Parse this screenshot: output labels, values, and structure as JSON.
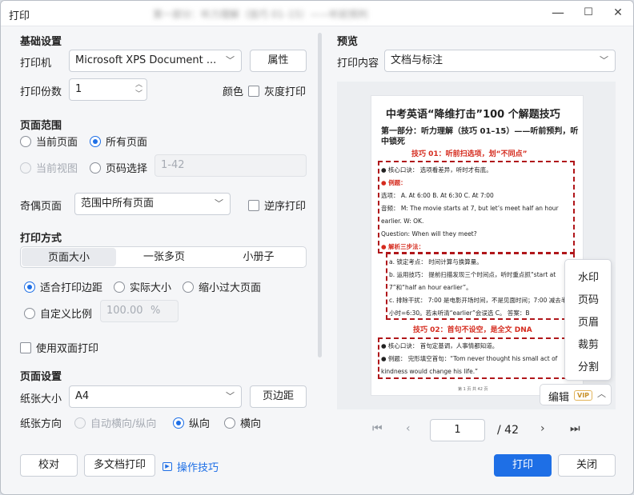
{
  "window": {
    "title": "打印",
    "blurred_title": "第一部分：听力理解（技巧 01–15）——听前预判",
    "min": "—",
    "max": "☐",
    "close": "✕"
  },
  "basic": {
    "title": "基础设置",
    "printer_label": "打印机",
    "printer_value": "Microsoft XPS Document ...",
    "props": "属性",
    "copies_label": "打印份数",
    "copies_value": "1",
    "color_label": "颜色",
    "gray_label": "灰度打印"
  },
  "range": {
    "title": "页面范围",
    "current": "当前页面",
    "all": "所有页面",
    "view": "当前视图",
    "pages": "页码选择",
    "pages_placeholder": "1-42"
  },
  "odd": {
    "label": "奇偶页面",
    "value": "范围中所有页面",
    "reverse": "逆序打印"
  },
  "mode": {
    "title": "打印方式",
    "tabs": [
      "页面大小",
      "一张多页",
      "小册子"
    ],
    "fit": "适合打印边距",
    "actual": "实际大小",
    "shrink": "缩小过大页面",
    "custom": "自定义比例",
    "custom_value": "100.00",
    "custom_unit": "%",
    "duplex": "使用双面打印"
  },
  "pagesetup": {
    "title": "页面设置",
    "size_label": "纸张大小",
    "size_value": "A4",
    "margin": "页边距",
    "orient_label": "纸张方向",
    "auto": "自动横向/纵向",
    "portrait": "纵向",
    "landscape": "横向"
  },
  "preview": {
    "title": "预览",
    "content_label": "打印内容",
    "content_value": "文档与标注"
  },
  "doc": {
    "title": "中考英语“降维打击”100 个解题技巧",
    "subtitle": "第一部分：听力理解（技巧 01–15）——听前预判，听中锁死",
    "tip1": "技巧 01：听前扫选项，划“不同点”",
    "l1": "● 核心口诀： 选项看差异，听时才有底。",
    "l2": "● 例题：",
    "l3": "选项： A. At 6:00 B. At 6:30 C. At 7:00",
    "l4": "音频： M: The movie starts at 7, but let’s meet half an hour",
    "l5": "earlier. W: OK.",
    "l6": "Question: When will they meet?",
    "l7": "● 解析三步法：",
    "l8": "a. 锁定考点： 时间计算与换算量。",
    "l9": "b. 运用技巧： 提前扫描发现三个时间点，听时重点抓“start at",
    "l10": "7”和“half an hour earlier”。",
    "l11": "c. 排除干扰： 7:00 是电影开场时间，不是见面时间；7:00 减去半",
    "l12": "小时=6:30。若未听清“earlier”会误选 C。 答案：B",
    "tip2": "技巧 02：首句不设空，是全文 DNA",
    "l13": "● 核心口诀： 首句定基调，人事情都知道。",
    "l14": "● 例题： 完形填空首句：“Tom never thought his small act of",
    "l15": "kindness would change his life.”",
    "footer": "第 1 页 共 42 页"
  },
  "menu": [
    "水印",
    "页码",
    "页眉",
    "裁剪",
    "分割"
  ],
  "edit": {
    "label": "编辑",
    "vip": "VIP"
  },
  "pager": {
    "current": "1",
    "total": "/ 42"
  },
  "footer": {
    "proof": "校对",
    "multi": "多文档打印",
    "tips": "操作技巧",
    "print": "打印",
    "close": "关闭"
  },
  "colors": {
    "accent": "#1e6fe6",
    "doc_red": "#d52b1e",
    "dash": "#b0161a"
  }
}
